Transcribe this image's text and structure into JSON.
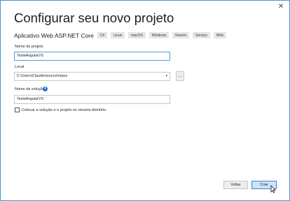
{
  "window": {
    "close_glyph": "✕"
  },
  "title": "Configurar seu novo projeto",
  "template": {
    "name": "Aplicativo Web ASP.NET Core",
    "tags": [
      "C#",
      "Linux",
      "macOS",
      "Windows",
      "Nuvem",
      "Serviço",
      "Web"
    ]
  },
  "project_name": {
    "label": "Nome do projeto",
    "value": "TesteAngularVS"
  },
  "location": {
    "label": "Local",
    "value": "C:\\Users\\Claudio\\source\\repos",
    "browse_label": "..."
  },
  "solution_name": {
    "label": "Nome da solução",
    "value": "TesteAngularVS"
  },
  "same_directory": {
    "label": "Colocar a solução e o projeto no mesmo diretório",
    "checked": false
  },
  "buttons": {
    "back": "Voltar",
    "create": "Criar"
  },
  "colors": {
    "accent": "#1e73c8",
    "window_border": "#3c9bd6",
    "tag_bg": "#e6e6e6"
  },
  "icons": [
    "close-icon",
    "dropdown-arrow-icon",
    "info-icon",
    "mouse-cursor-icon"
  ]
}
